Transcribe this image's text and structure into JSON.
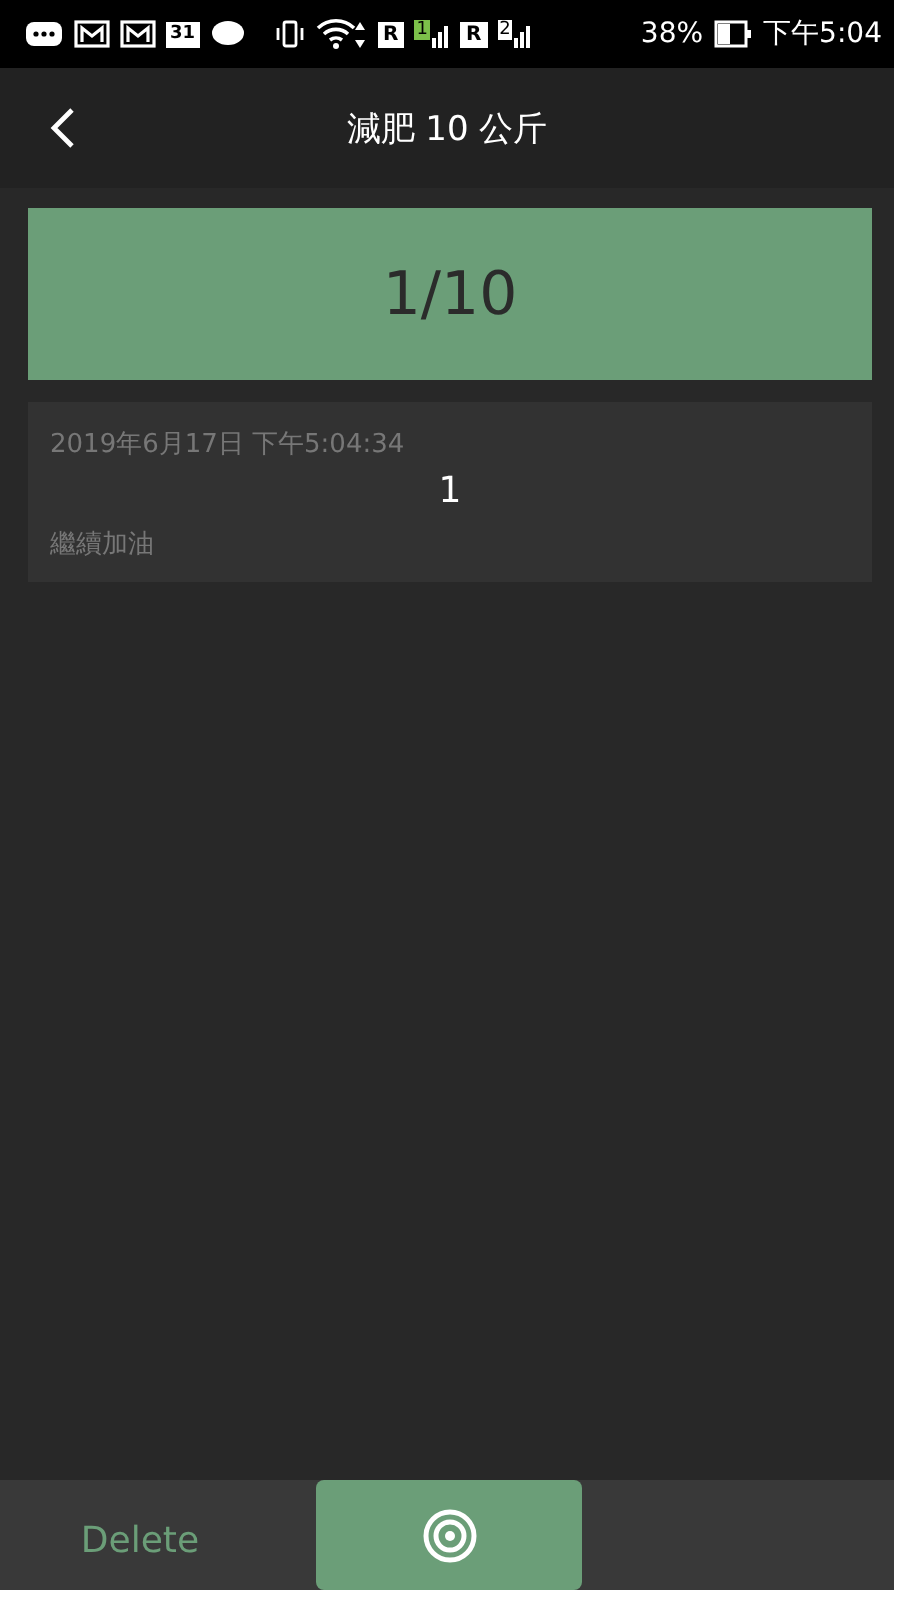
{
  "status_bar": {
    "calendar_day": "31",
    "sims": [
      {
        "roaming": "R",
        "slot": "1"
      },
      {
        "roaming": "R",
        "slot": "2"
      }
    ],
    "battery": "38%",
    "time": "下午5:04"
  },
  "header": {
    "title": "減肥 10 公斤"
  },
  "goal": {
    "progress": "1/10"
  },
  "records": [
    {
      "date": "2019年6月17日 下午5:04:34",
      "amount": "1",
      "note": "繼續加油"
    }
  ],
  "bottom_bar": {
    "delete": "Delete"
  }
}
